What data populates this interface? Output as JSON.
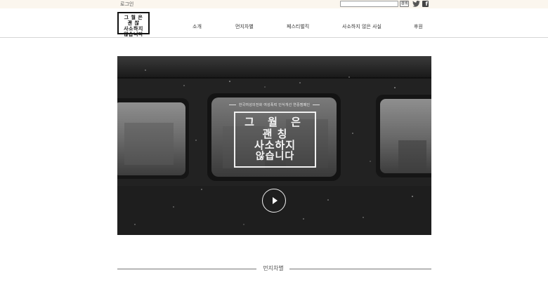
{
  "topbar": {
    "login_label": "로그인",
    "search_placeholder": "",
    "search_button_label": "검색",
    "social": [
      "twitter-icon",
      "facebook-icon"
    ]
  },
  "header": {
    "logo_lines": [
      "그 월 은",
      "괜 찮",
      "사소하지",
      "않습니다"
    ],
    "nav": [
      "소개",
      "먼지차별",
      "페스티벌킥",
      "사소하지 않은 사실",
      "후원"
    ]
  },
  "video": {
    "subtitle": "한국여성의전화 여성폭력 인식개선 연중캠페인",
    "title_lines": [
      "그 월 은",
      "괜 칭",
      "사소하지",
      "않습니다"
    ]
  },
  "section": {
    "title": "먼지차별"
  },
  "colors": {
    "topbar_bg": "#fbf6ee",
    "video_bg": "#1c1c1c",
    "text": "#333333"
  }
}
